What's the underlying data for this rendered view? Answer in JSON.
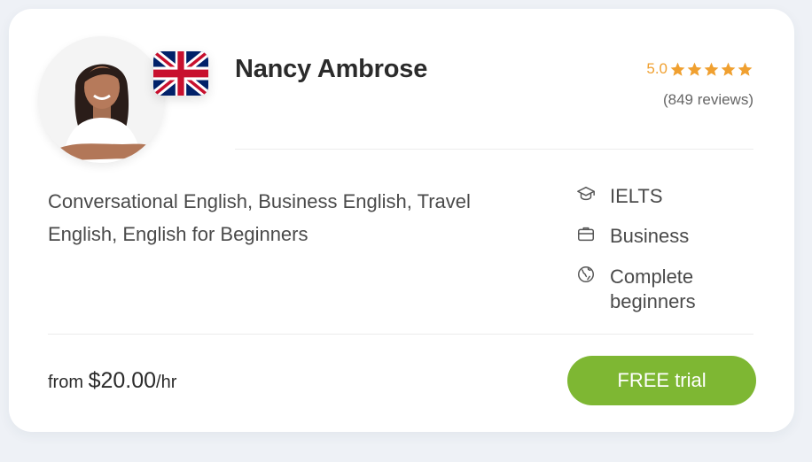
{
  "tutor": {
    "name": "Nancy Ambrose",
    "rating": "5.0",
    "star_count": 5,
    "reviews": "(849 reviews)",
    "flag_icon": "uk-flag-icon",
    "subjects": "Conversational English, Business English, Travel English, English for Beginners",
    "features": [
      {
        "icon": "graduation-cap-icon",
        "label": "IELTS"
      },
      {
        "icon": "briefcase-icon",
        "label": "Business"
      },
      {
        "icon": "globe-icon",
        "label": "Complete beginners"
      }
    ],
    "price": {
      "prefix": "from ",
      "amount": "$20.00",
      "unit": "/hr"
    },
    "cta_label": "FREE trial"
  },
  "colors": {
    "accent_green": "#7eb733",
    "star_gold": "#f0a030",
    "text_dark": "#2b2b2b",
    "text_body": "#4a4a4a"
  }
}
